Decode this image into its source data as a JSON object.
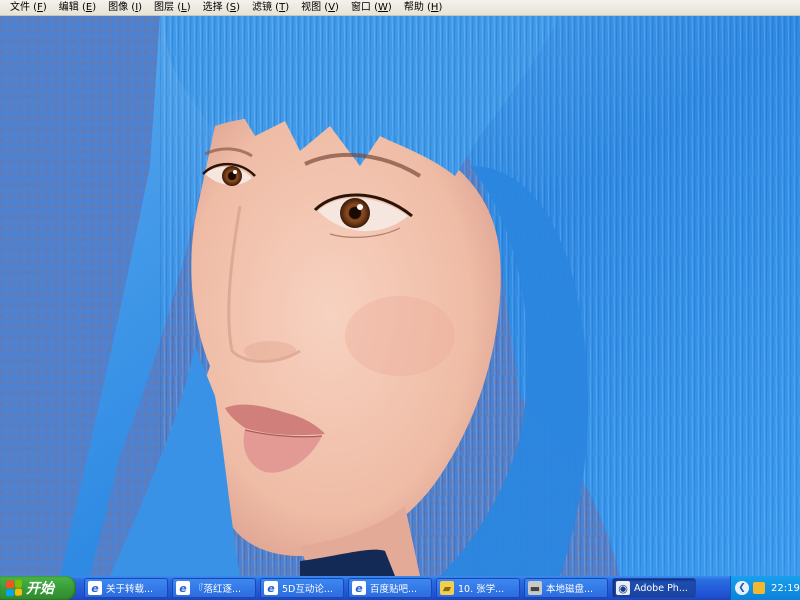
{
  "menu": [
    {
      "label": "文件",
      "key": "F"
    },
    {
      "label": "编辑",
      "key": "E"
    },
    {
      "label": "图像",
      "key": "I"
    },
    {
      "label": "图层",
      "key": "L"
    },
    {
      "label": "选择",
      "key": "S"
    },
    {
      "label": "滤镜",
      "key": "T"
    },
    {
      "label": "视图",
      "key": "V"
    },
    {
      "label": "窗口",
      "key": "W"
    },
    {
      "label": "帮助",
      "key": "H"
    }
  ],
  "taskbar": {
    "start_label": "开始",
    "tasks": [
      {
        "label": "关于转载...",
        "icon": "ie-icon"
      },
      {
        "label": "『落红逐...",
        "icon": "ie-icon"
      },
      {
        "label": "5D互动论...",
        "icon": "ie-icon"
      },
      {
        "label": "百度贴吧...",
        "icon": "ie-icon"
      },
      {
        "label": "10. 张学...",
        "icon": "folder-icon"
      },
      {
        "label": "本地磁盘...",
        "icon": "drive-icon"
      },
      {
        "label": "Adobe Ph...",
        "icon": "ps-icon"
      }
    ],
    "clock": "22:19"
  },
  "colors": {
    "background": "#4d82d2",
    "hair": "#3c95e8",
    "skin": "#f2c3ae",
    "taskbar": "#245edb",
    "start": "#3b9c3a"
  }
}
